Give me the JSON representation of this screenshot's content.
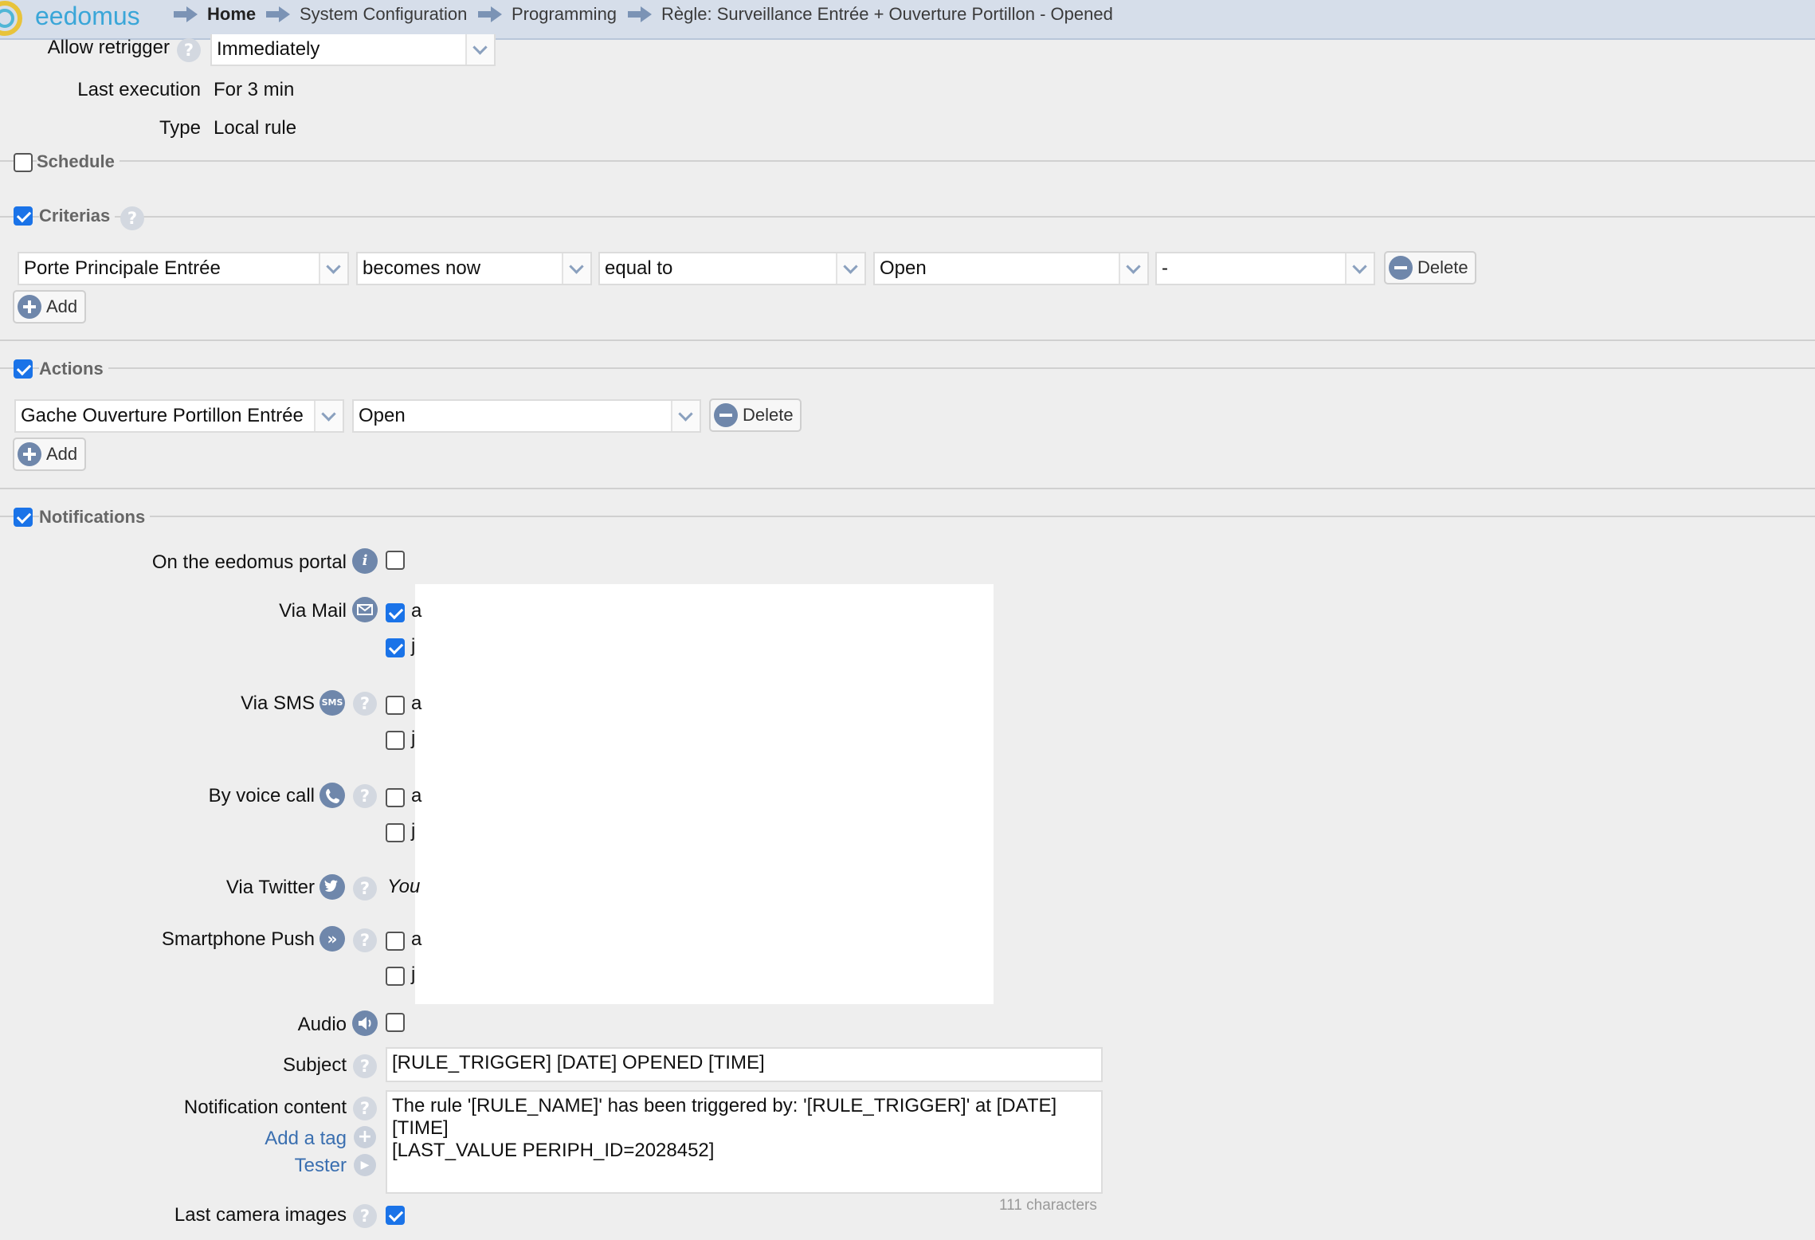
{
  "app": {
    "logo": "eedomus"
  },
  "breadcrumb": [
    {
      "label": "Home"
    },
    {
      "label": "System Configuration"
    },
    {
      "label": "Programming"
    },
    {
      "label": "Règle: Surveillance Entrée + Ouverture Portillon - Opened"
    }
  ],
  "info": {
    "allow_retrigger_label": "Allow retrigger",
    "allow_retrigger_value": "Immediately",
    "last_execution_label": "Last execution",
    "last_execution_value": "For 3 min",
    "type_label": "Type",
    "type_value": "Local rule"
  },
  "schedule": {
    "title": "Schedule",
    "checked": false
  },
  "criterias": {
    "title": "Criterias",
    "checked": true,
    "row": {
      "device": "Porte Principale Entrée",
      "when": "becomes now",
      "operator": "equal to",
      "value": "Open",
      "extra": "-",
      "delete_label": "Delete"
    },
    "add_label": "Add"
  },
  "actions": {
    "title": "Actions",
    "checked": true,
    "row": {
      "device": "Gache Ouverture Portillon Entrée",
      "action": "Open",
      "delete_label": "Delete"
    },
    "add_label": "Add"
  },
  "notifications": {
    "title": "Notifications",
    "checked": true,
    "portal_label": "On the eedomus portal",
    "mail_label": "Via Mail",
    "sms_label": "Via SMS",
    "sms_icon_text": "SMS",
    "voice_label": "By voice call",
    "twitter_label": "Via Twitter",
    "twitter_text": "You",
    "push_label": "Smartphone Push",
    "audio_label": "Audio",
    "recipient_a": "a",
    "recipient_j": "j",
    "subject_label": "Subject",
    "subject_value": "[RULE_TRIGGER] [DATE] OPENED [TIME]",
    "content_label": "Notification content",
    "content_line1": "The rule '[RULE_NAME]' has been triggered by: '[RULE_TRIGGER]' at  [DATE]",
    "content_line2": "[TIME]",
    "content_line3": "[LAST_VALUE PERIPH_ID=2028452]",
    "add_tag_label": "Add a tag",
    "tester_label": "Tester",
    "char_count": "111 characters",
    "camera_label": "Last camera images"
  },
  "colors": {
    "topbar": "#d6deea",
    "accent": "#1a73e8",
    "icon": "#6f87ab"
  }
}
